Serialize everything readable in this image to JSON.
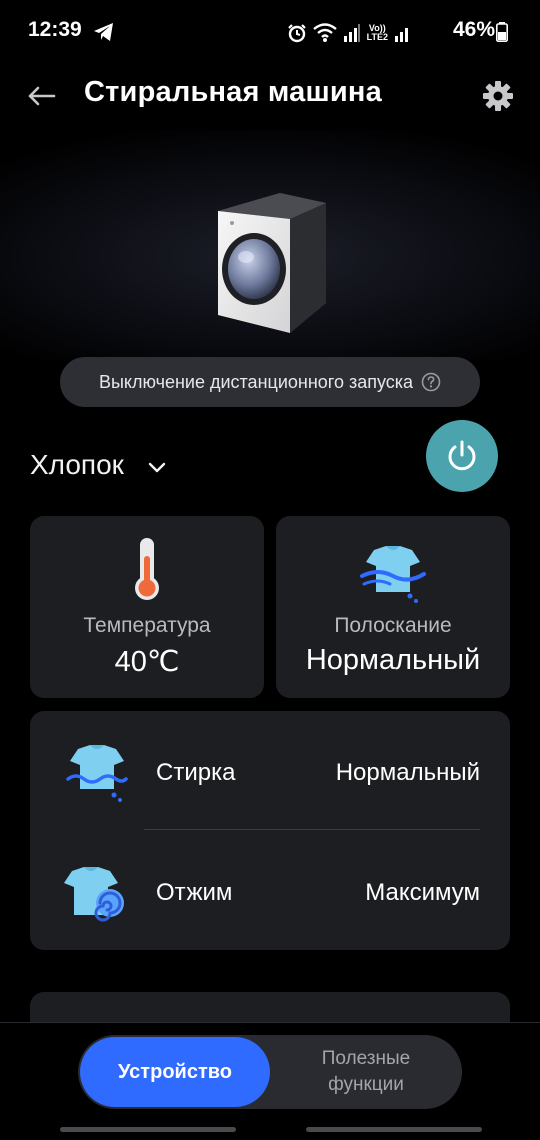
{
  "status_bar": {
    "time": "12:39",
    "battery": "46%",
    "network_label_top": "Vo))",
    "network_label_bottom": "LTE2",
    "icons": [
      "telegram-icon",
      "alarm-icon",
      "wifi-icon",
      "signal-icon",
      "battery-icon"
    ]
  },
  "header": {
    "title": "Стиральная машина",
    "back_icon": "arrow-left-icon",
    "settings_icon": "gear-icon"
  },
  "remote": {
    "label": "Выключение дистанционного запуска",
    "help_icon": "question-circle-icon"
  },
  "course": {
    "selected": "Хлопок",
    "power_icon": "power-icon",
    "power_color": "#4aa3ad"
  },
  "cards": {
    "temperature": {
      "label": "Температура",
      "value": "40℃",
      "icon": "thermometer-icon"
    },
    "rinse": {
      "label": "Полоскание",
      "value": "Нормальный",
      "icon": "shirt-wave-icon"
    }
  },
  "settings_list": [
    {
      "label": "Стирка",
      "value": "Нормальный",
      "icon": "shirt-wash-icon"
    },
    {
      "label": "Отжим",
      "value": "Максимум",
      "icon": "shirt-spin-icon"
    }
  ],
  "bottom_nav": {
    "tabs": [
      {
        "label": "Устройство",
        "active": true
      },
      {
        "label": "Полезные\nфункции",
        "active": false
      }
    ],
    "accent": "#2f6bff"
  }
}
